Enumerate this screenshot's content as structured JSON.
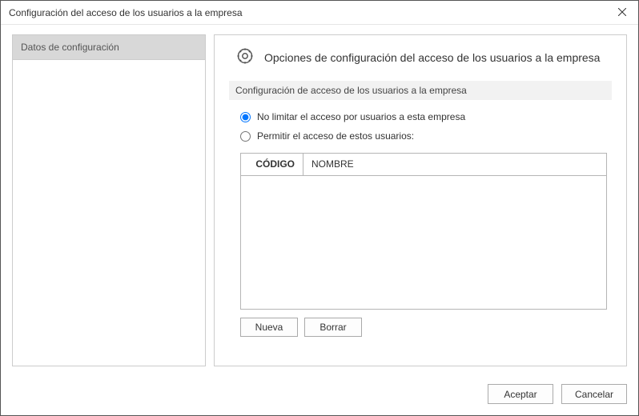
{
  "window": {
    "title": "Configuración del acceso de los usuarios a la empresa"
  },
  "sidebar": {
    "items": [
      {
        "label": "Datos de configuración"
      }
    ]
  },
  "main": {
    "heading": "Opciones de configuración del acceso de los usuarios a la empresa",
    "section_label": "Configuración de acceso de los usuarios a la empresa",
    "radio_no_limit": "No limitar el acceso por usuarios a esta empresa",
    "radio_allow": "Permitir el acceso de estos usuarios:",
    "table": {
      "col_code": "CÓDIGO",
      "col_name": "NOMBRE"
    },
    "btn_new": "Nueva",
    "btn_delete": "Borrar"
  },
  "footer": {
    "accept": "Aceptar",
    "cancel": "Cancelar"
  }
}
